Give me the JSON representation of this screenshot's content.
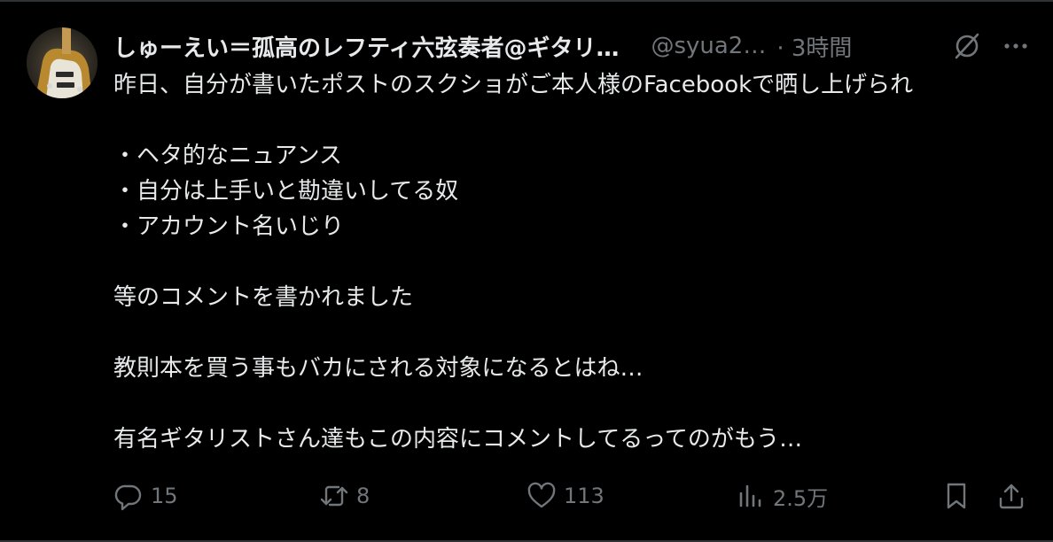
{
  "post": {
    "author": {
      "display_name": "しゅーえい＝孤高のレフティ六弦奏者@ギタリ…",
      "handle": "@syua2…",
      "time": "· 3時間"
    },
    "body_lines": [
      "昨日、自分が書いたポストのスクショがご本人様のFacebookで晒し上げられ",
      "",
      "・ヘタ的なニュアンス",
      "・自分は上手いと勘違いしてる奴",
      "・アカウント名いじり",
      "",
      "等のコメントを書かれました",
      "",
      "教則本を買う事もバカにされる対象になるとはね…",
      "",
      "有名ギタリストさん達もこの内容にコメントしてるってのがもう…"
    ],
    "actions": {
      "reply_count": "15",
      "repost_count": "8",
      "like_count": "113",
      "views_count": "2.5万"
    }
  },
  "icons": {
    "grok": "grok-icon",
    "more": "more-icon",
    "reply": "reply-icon",
    "repost": "repost-icon",
    "like": "heart-icon",
    "views": "views-icon",
    "bookmark": "bookmark-icon",
    "share": "share-icon"
  },
  "colors": {
    "background": "#000000",
    "text_primary": "#e7e9ea",
    "text_secondary": "#71767b",
    "border": "#2f3336"
  }
}
